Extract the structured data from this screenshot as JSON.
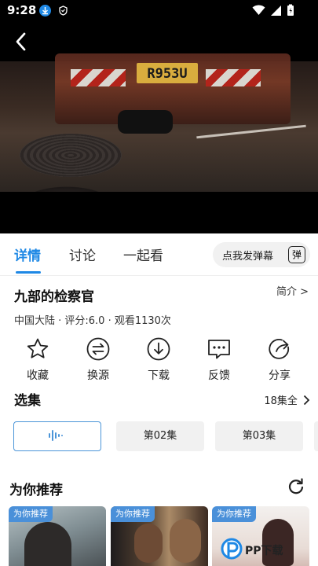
{
  "status": {
    "time": "9:28"
  },
  "video": {
    "plate": "R953U"
  },
  "tabs": [
    {
      "label": "详情"
    },
    {
      "label": "讨论"
    },
    {
      "label": "一起看"
    }
  ],
  "danmu": {
    "label": "点我发弹幕",
    "icon_label": "弹"
  },
  "info": {
    "title": "九部的检察官",
    "intro_label": "简介 >",
    "meta": "中国大陆 · 评分:6.0 · 观看1130次"
  },
  "actions": [
    {
      "label": "收藏",
      "icon": "star-icon"
    },
    {
      "label": "换源",
      "icon": "swap-icon"
    },
    {
      "label": "下载",
      "icon": "download-icon"
    },
    {
      "label": "反馈",
      "icon": "feedback-icon"
    },
    {
      "label": "分享",
      "icon": "share-icon"
    }
  ],
  "episodes": {
    "title": "选集",
    "all_label": "18集全",
    "items": [
      {
        "label": ""
      },
      {
        "label": "第02集"
      },
      {
        "label": "第03集"
      }
    ]
  },
  "recommend": {
    "title": "为你推荐",
    "badge": "为你推荐"
  },
  "watermark": {
    "text": "PP下载"
  },
  "colors": {
    "accent": "#1e88e5",
    "badge": "#4a90d9"
  }
}
